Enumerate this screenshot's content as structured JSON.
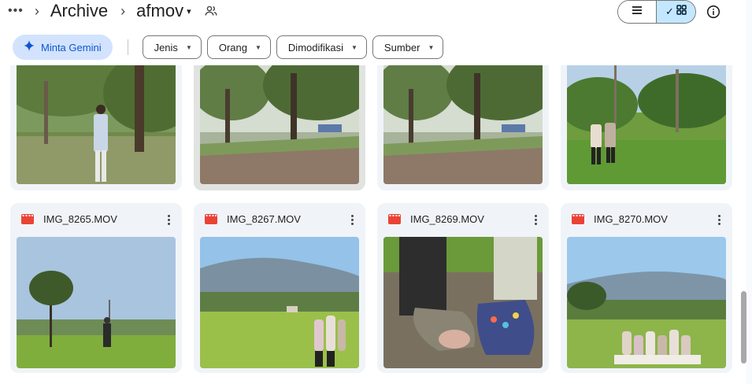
{
  "breadcrumb": {
    "more": "•••",
    "separator": "›",
    "parent": "Archive",
    "current": "afmov",
    "caret": "▾",
    "shared_icon": "people-icon"
  },
  "view_toggle": {
    "list_icon": "list-icon",
    "grid_icon": "grid-icon",
    "selected": "grid",
    "check": "✓"
  },
  "info_icon": "info-icon",
  "filters": {
    "gemini_label": "Minta Gemini",
    "gemini_icon": "sparkle-icon",
    "chips": [
      {
        "label": "Jenis"
      },
      {
        "label": "Orang"
      },
      {
        "label": "Dimodifikasi"
      },
      {
        "label": "Sumber"
      }
    ],
    "caret": "▼"
  },
  "files_row1": [
    {
      "name": "",
      "scene": "person-trees",
      "selected": false
    },
    {
      "name": "",
      "scene": "trees-field",
      "selected": true
    },
    {
      "name": "",
      "scene": "trees-field",
      "selected": false
    },
    {
      "name": "",
      "scene": "palms-people",
      "selected": false
    }
  ],
  "files_row2": [
    {
      "name": "IMG_8265.MOV",
      "type_icon": "video-icon",
      "scene": "field-tree-tower"
    },
    {
      "name": "IMG_8267.MOV",
      "type_icon": "video-icon",
      "scene": "mountain-people"
    },
    {
      "name": "IMG_8269.MOV",
      "type_icon": "video-icon",
      "scene": "feet-sandals"
    },
    {
      "name": "IMG_8270.MOV",
      "type_icon": "video-icon",
      "scene": "mountain-group"
    }
  ],
  "colors": {
    "accent": "#0b57d0",
    "gemini_bg": "#d3e3fd",
    "selected_toggle": "#c2e7ff",
    "card_bg": "#f0f4f9",
    "video_icon": "#ea4335"
  }
}
